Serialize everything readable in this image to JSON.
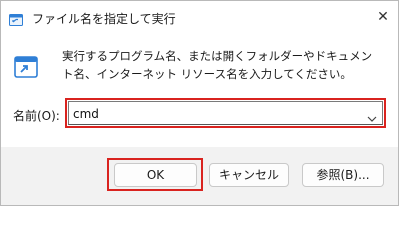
{
  "window": {
    "title": "ファイル名を指定して実行",
    "close_glyph": "✕",
    "app_icon": "run-icon"
  },
  "content": {
    "icon": "run-dialog-icon",
    "description": "実行するプログラム名、または開くフォルダーやドキュメント名、インターネット リソース名を入力してください。"
  },
  "open_field": {
    "label": "名前(O):",
    "value": "cmd"
  },
  "buttons": {
    "ok": "OK",
    "cancel": "キャンセル",
    "browse": "参照(B)..."
  },
  "colors": {
    "highlight": "#d9231f",
    "icon_blue": "#2f7fd6"
  }
}
